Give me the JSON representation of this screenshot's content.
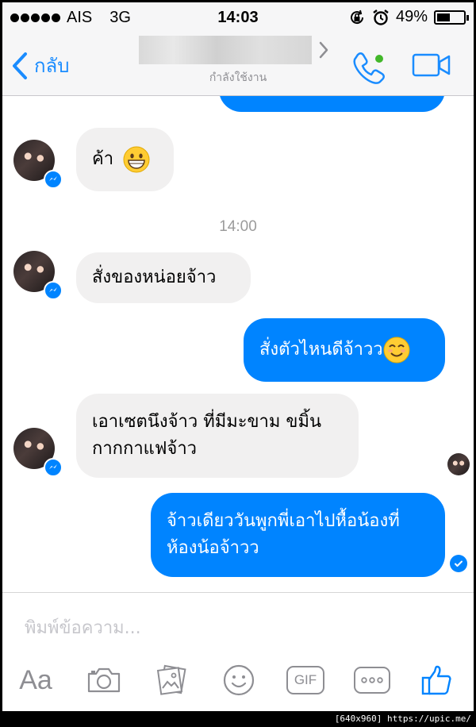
{
  "status_bar": {
    "carrier": "AIS",
    "network": "3G",
    "time": "14:03",
    "battery": "49%",
    "battery_level": 0.49
  },
  "header": {
    "back_label": "กลับ",
    "status": "กำลังใช้งาน"
  },
  "conversation": {
    "timestamp": "14:00",
    "messages": [
      {
        "sender": "other",
        "text": "ค้า"
      },
      {
        "sender": "other",
        "text": "สั่งของหน่อยจ้าว"
      },
      {
        "sender": "me",
        "text": "สั่งตัวไหนดีจ้าวว"
      },
      {
        "sender": "other",
        "line1": "เอาเซตนึงจ้าว ที่มีมะขาม ขมิ้น",
        "line2": "กากกาแฟจ้าว"
      },
      {
        "sender": "me",
        "line1": "จ้าวเดียววันพูกพี่เอาไปหื้อน้องที่",
        "line2": "ห้องน้อจ้าวว"
      }
    ]
  },
  "composer": {
    "placeholder": "พิมพ์ข้อความ...",
    "aa_label": "Aa",
    "gif_label": "GIF"
  },
  "watermark": "[640x960] https://upic.me/",
  "colors": {
    "accent": "#0084ff",
    "incoming_bubble": "#f1f0f0",
    "online": "#42b72a"
  }
}
